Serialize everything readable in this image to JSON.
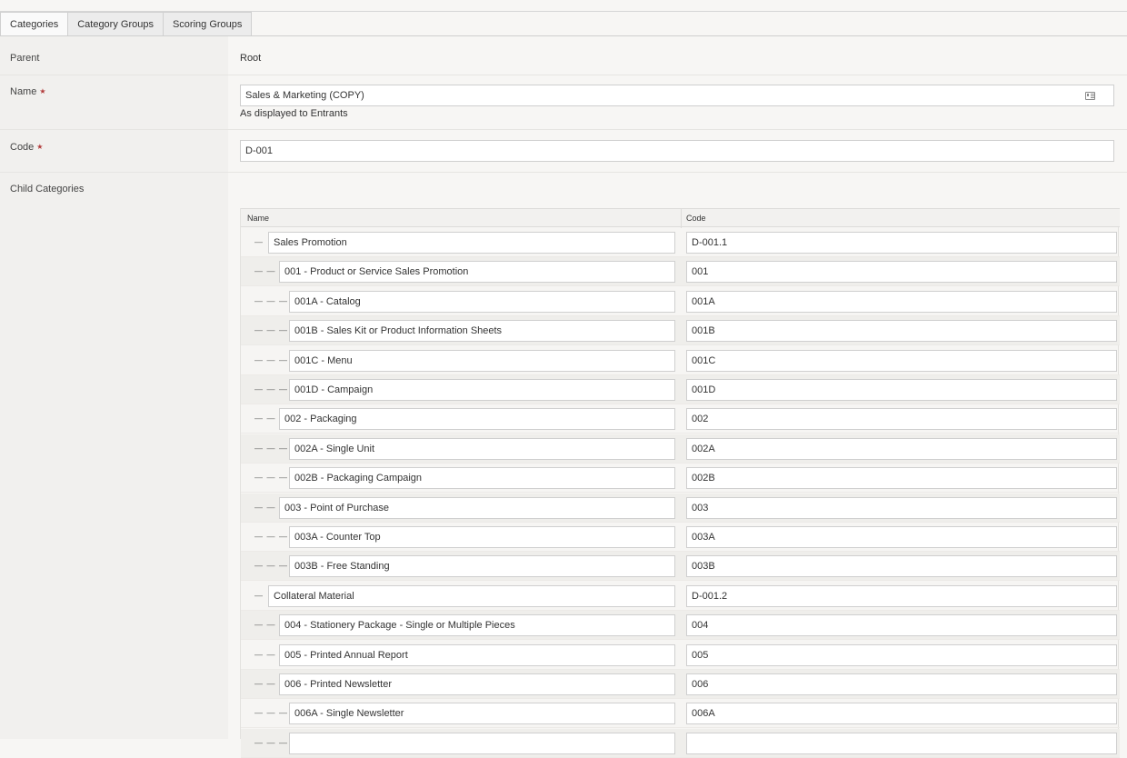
{
  "tabs": [
    {
      "label": "Categories"
    },
    {
      "label": "Category Groups"
    },
    {
      "label": "Scoring Groups"
    }
  ],
  "form": {
    "parent_label": "Parent",
    "parent_value": "Root",
    "name_label": "Name",
    "name_value": "Sales & Marketing (COPY)",
    "name_help": "As displayed to Entrants",
    "code_label": "Code",
    "code_value": "D-001",
    "child_label": "Child Categories",
    "required_mark": "★"
  },
  "grid": {
    "headers": {
      "name": "Name",
      "code": "Code"
    },
    "rows": [
      {
        "level": 1,
        "indent": "—",
        "name": "Sales Promotion",
        "code": "D-001.1"
      },
      {
        "level": 2,
        "indent": "— —",
        "name": "001 - Product or Service Sales Promotion",
        "code": "001"
      },
      {
        "level": 3,
        "indent": "— — —",
        "name": "001A - Catalog",
        "code": "001A"
      },
      {
        "level": 3,
        "indent": "— — —",
        "name": "001B - Sales Kit or Product Information Sheets",
        "code": "001B"
      },
      {
        "level": 3,
        "indent": "— — —",
        "name": "001C - Menu",
        "code": "001C"
      },
      {
        "level": 3,
        "indent": "— — —",
        "name": "001D - Campaign",
        "code": "001D"
      },
      {
        "level": 2,
        "indent": "— —",
        "name": "002 - Packaging",
        "code": "002"
      },
      {
        "level": 3,
        "indent": "— — —",
        "name": "002A - Single Unit",
        "code": "002A"
      },
      {
        "level": 3,
        "indent": "— — —",
        "name": "002B - Packaging Campaign",
        "code": "002B"
      },
      {
        "level": 2,
        "indent": "— —",
        "name": "003 - Point of Purchase",
        "code": "003"
      },
      {
        "level": 3,
        "indent": "— — —",
        "name": "003A - Counter Top",
        "code": "003A"
      },
      {
        "level": 3,
        "indent": "— — —",
        "name": "003B - Free Standing",
        "code": "003B"
      },
      {
        "level": 1,
        "indent": "—",
        "name": "Collateral Material",
        "code": "D-001.2"
      },
      {
        "level": 2,
        "indent": "— —",
        "name": "004 - Stationery Package - Single or Multiple Pieces",
        "code": "004"
      },
      {
        "level": 2,
        "indent": "— —",
        "name": "005 - Printed Annual Report",
        "code": "005"
      },
      {
        "level": 2,
        "indent": "— —",
        "name": "006 - Printed Newsletter",
        "code": "006"
      },
      {
        "level": 3,
        "indent": "— — —",
        "name": "006A - Single Newsletter",
        "code": "006A"
      },
      {
        "level": 3,
        "indent": "— — —",
        "name": "",
        "code": ""
      }
    ]
  }
}
